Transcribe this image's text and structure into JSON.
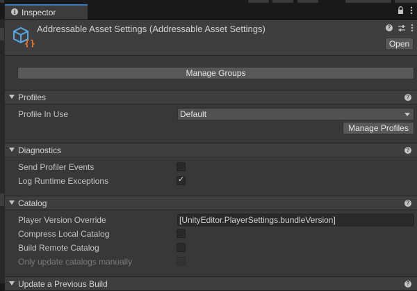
{
  "window": {
    "tab_title": "Inspector",
    "tab_icons": [
      "lock-icon",
      "more-options-icon"
    ]
  },
  "header": {
    "title": "Addressable Asset Settings (Addressable Asset Settings)",
    "open_label": "Open",
    "icons": [
      "help-icon",
      "preset-icon",
      "context-menu-icon"
    ]
  },
  "manage_groups_label": "Manage Groups",
  "sections": {
    "profiles": {
      "title": "Profiles",
      "profile_in_use_label": "Profile In Use",
      "profile_in_use_value": "Default",
      "manage_profiles_label": "Manage Profiles"
    },
    "diagnostics": {
      "title": "Diagnostics",
      "send_profiler_events_label": "Send Profiler Events",
      "send_profiler_events_checked": false,
      "log_runtime_exceptions_label": "Log Runtime Exceptions",
      "log_runtime_exceptions_checked": true
    },
    "catalog": {
      "title": "Catalog",
      "player_version_override_label": "Player Version Override",
      "player_version_override_value": "[UnityEditor.PlayerSettings.bundleVersion]",
      "compress_local_catalog_label": "Compress Local Catalog",
      "compress_local_catalog_checked": false,
      "build_remote_catalog_label": "Build Remote Catalog",
      "build_remote_catalog_checked": false,
      "only_update_catalogs_manually_label": "Only update catalogs manually",
      "only_update_catalogs_manually_checked": false
    },
    "update_previous_build": {
      "title": "Update a Previous Build"
    }
  },
  "colors": {
    "accent_tab": "#3a79bb",
    "icon_blue": "#57a9e8",
    "icon_orange": "#f07a2c"
  }
}
